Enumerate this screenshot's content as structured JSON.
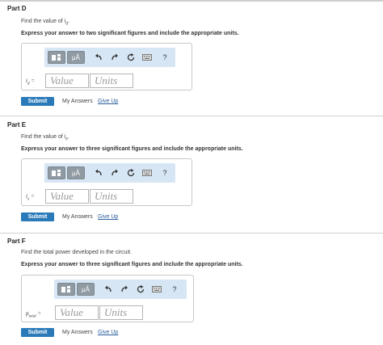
{
  "parts": [
    {
      "title": "Part D",
      "prompt": "Find the value of i",
      "prompt_sub": "d",
      "instruction": "Express your answer to two significant figures and include the appropriate units.",
      "symbol": "i",
      "symbol_sub": "d",
      "value_placeholder": "Value",
      "units_placeholder": "Units"
    },
    {
      "title": "Part E",
      "prompt": "Find the value of i",
      "prompt_sub": "e",
      "instruction": "Express your answer to three significant figures and include the appropriate units.",
      "symbol": "i",
      "symbol_sub": "e",
      "value_placeholder": "Value",
      "units_placeholder": "Units"
    },
    {
      "title": "Part F",
      "prompt": "Find the total power developed in the circuit.",
      "prompt_sub": "",
      "instruction": "Express your answer to three significant figures and include the appropriate units.",
      "symbol": "p",
      "symbol_sub": "total",
      "value_placeholder": "Value",
      "units_placeholder": "Units"
    }
  ],
  "toolbar": {
    "units_label": "μÅ",
    "help_label": "?"
  },
  "actions": {
    "submit": "Submit",
    "my_answers": "My Answers",
    "give_up": "Give Up"
  },
  "colors": {
    "submit": "#2a7ab9",
    "toolbar_bg": "#d6e6f5",
    "link": "#2a5d9c"
  }
}
